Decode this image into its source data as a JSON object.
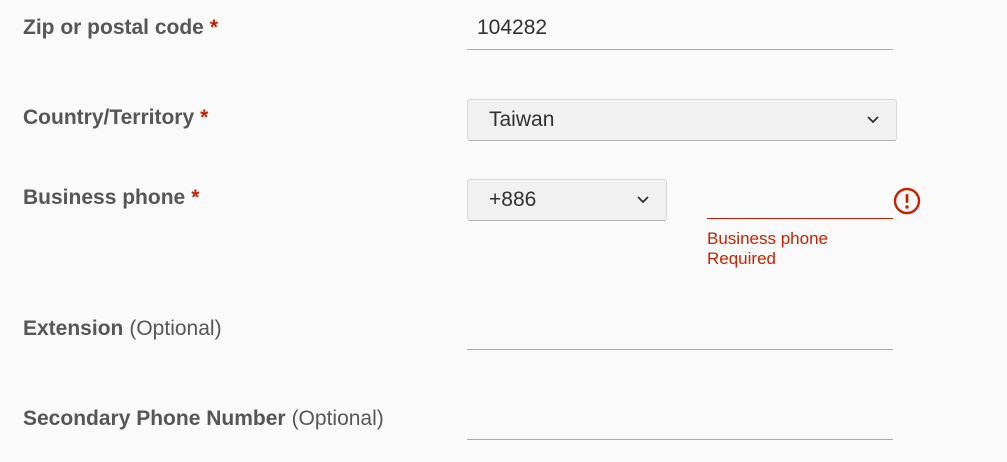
{
  "zip": {
    "label": "Zip or postal code",
    "required_mark": "*",
    "value": "104282"
  },
  "country": {
    "label": "Country/Territory",
    "required_mark": "*",
    "selected": "Taiwan"
  },
  "business_phone": {
    "label": "Business phone",
    "required_mark": "*",
    "country_code": "+886",
    "value": "",
    "error_line1": "Business phone",
    "error_line2": "Required"
  },
  "extension": {
    "label": "Extension",
    "optional": "(Optional)",
    "value": ""
  },
  "secondary_phone": {
    "label": "Secondary Phone Number",
    "optional": "(Optional)",
    "value": ""
  },
  "colors": {
    "error": "#c92100",
    "label": "#565656",
    "background": "#fafafa"
  },
  "icons": {
    "select_chevron": "chevron-down-icon",
    "error": "exclamation-circle-icon"
  }
}
